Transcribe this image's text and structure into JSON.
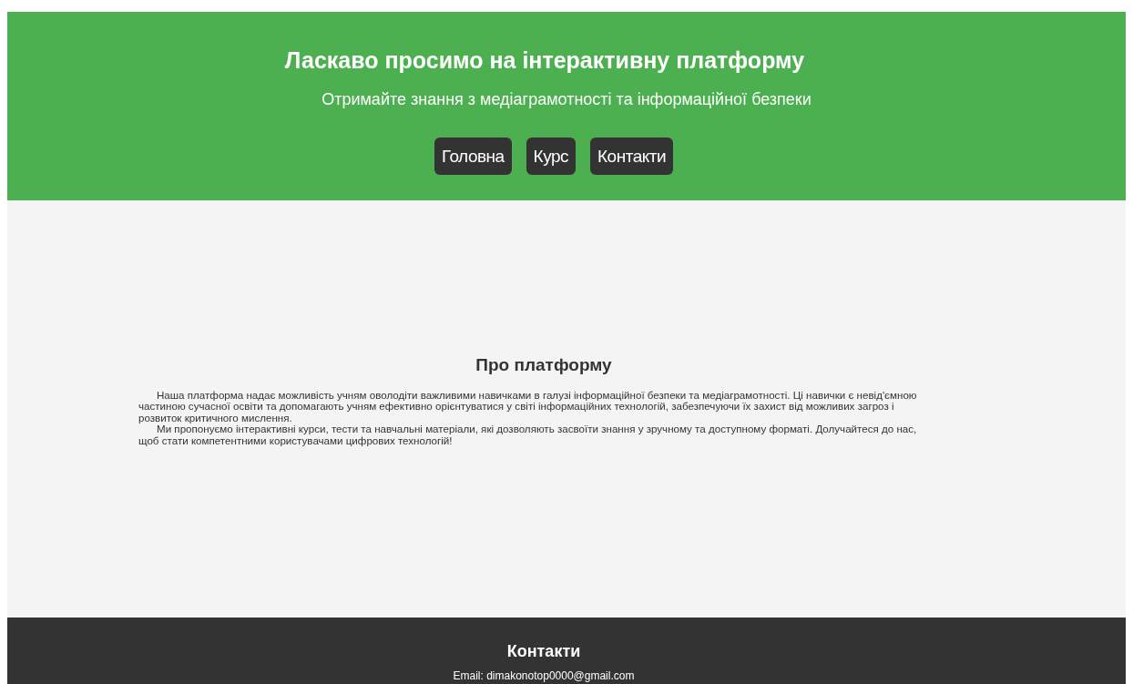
{
  "header": {
    "title": "Ласкаво просимо на інтерактивну платформу",
    "subtitle": "Отримайте знання з медіаграмотності та інформаційної безпеки"
  },
  "nav": [
    {
      "label": "Головна"
    },
    {
      "label": "Курс"
    },
    {
      "label": "Контакти"
    }
  ],
  "about": {
    "heading": "Про платформу",
    "paragraphs": [
      "Наша платформа надає можливість учням оволодіти важливими навичками в галузі інформаційної безпеки та медіаграмотності. Ці навички є невід'ємною частиною сучасної освіти та допомагають учням ефективно орієнтуватися у світі інформаційних технологій, забезпечуючи їх захист від можливих загроз і розвиток критичного мислення.",
      "Ми пропонуємо інтерактивні курси, тести та навчальні матеріали, які дозволяють засвоїти знання у зручному та доступному форматі. Долучайтеся до нас, щоб стати компетентними користувачами цифрових технологій!"
    ]
  },
  "footer": {
    "heading": "Контакти",
    "email": "Email: dimakonotop0000@gmail.com"
  }
}
